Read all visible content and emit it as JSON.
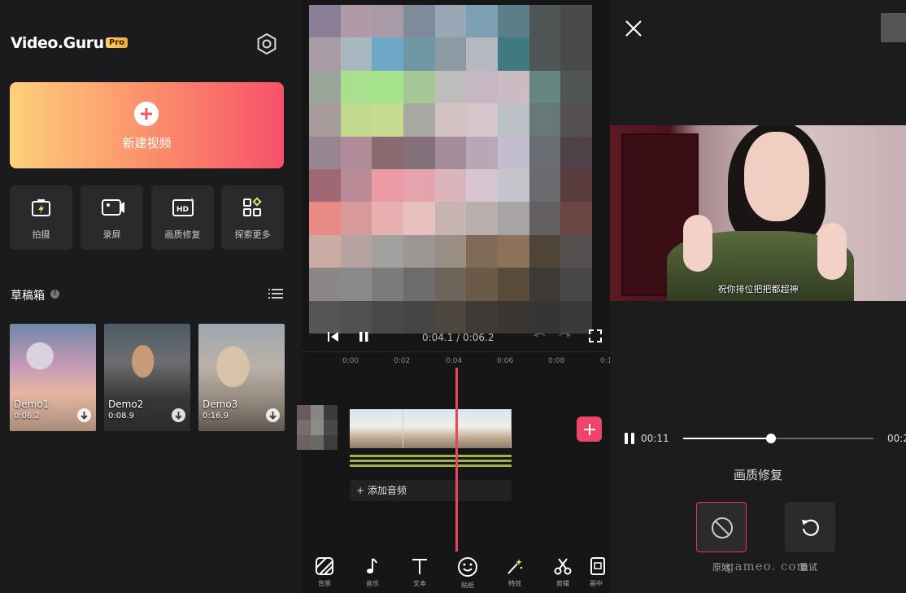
{
  "home": {
    "logo": "Video.Guru",
    "pro_badge": "Pro",
    "new_video_label": "新建视频",
    "tools": [
      {
        "label": "拍摄",
        "icon": "camera-icon"
      },
      {
        "label": "录屏",
        "icon": "screen-record-icon"
      },
      {
        "label": "画质修复",
        "icon": "hd-icon"
      },
      {
        "label": "探索更多",
        "icon": "grid-icon"
      }
    ],
    "drafts_title": "草稿箱",
    "drafts": [
      {
        "name": "Demo1",
        "duration": "0:06.2"
      },
      {
        "name": "Demo2",
        "duration": "0:08.9"
      },
      {
        "name": "Demo3",
        "duration": "0:16.9"
      }
    ]
  },
  "editor": {
    "time_readout": "0:04.1 / 0:06.2",
    "ruler_ticks": [
      "0:00",
      "0:02",
      "0:04",
      "0:06",
      "0:08",
      "0:1"
    ],
    "add_audio_label": "+ 添加音频",
    "toolbar": [
      {
        "label": "背景",
        "icon": "background-icon"
      },
      {
        "label": "音乐",
        "icon": "music-icon"
      },
      {
        "label": "文本",
        "icon": "text-icon"
      },
      {
        "label": "贴纸",
        "icon": "sticker-icon"
      },
      {
        "label": "特效",
        "icon": "effects-icon"
      },
      {
        "label": "剪辑",
        "icon": "scissors-icon"
      },
      {
        "label": "画中",
        "icon": "pip-icon"
      }
    ]
  },
  "enhance": {
    "subtitle": "祝你排位把把都超神",
    "current_time": "00:11",
    "end_time": "00:2",
    "progress_fraction": 0.46,
    "title": "画质修复",
    "options": [
      {
        "label": "原始",
        "icon": "disabled-icon",
        "selected": true
      },
      {
        "label": "重试",
        "icon": "retry-icon",
        "selected": false
      }
    ],
    "watermark": "gameo. com"
  },
  "colors": {
    "accent": "#f0446d",
    "new_video_gradient_start": "#fdd17c",
    "new_video_gradient_end": "#f8516a",
    "audio_track": "#a4b04c"
  }
}
